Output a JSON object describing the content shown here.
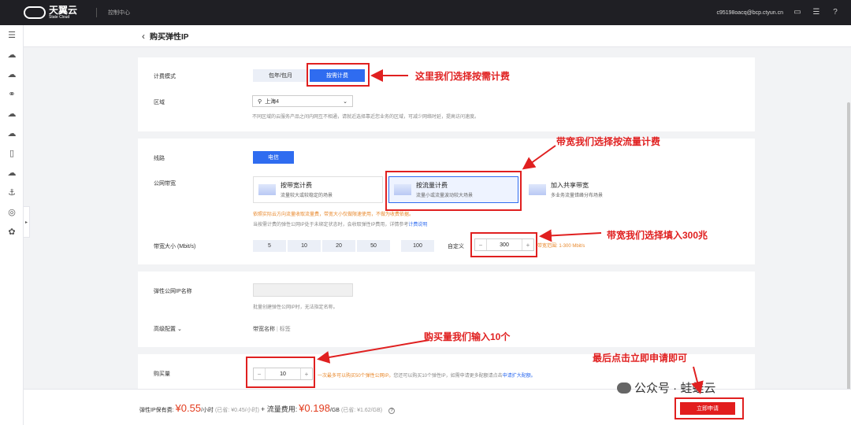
{
  "topbar": {
    "logo_cn": "天翼云",
    "logo_en": "State Cloud",
    "console": "控制中心",
    "account": "c95198oacq@bcp.ctyun.cn"
  },
  "page": {
    "back_icon": "chevron-left-icon",
    "title": "购买弹性IP"
  },
  "billing": {
    "label": "计费模式",
    "options": [
      "包年/包月",
      "按需计费"
    ],
    "selected": "按需计费",
    "region_label": "区域",
    "region_value": "上海4",
    "region_hint": "不同区域的云服务产品之间内网互不相通，请就近选择靠近您业务的区域，可减少网络时延，提高访问速度。"
  },
  "network": {
    "line_label": "线路",
    "line_value": "电信",
    "bandwidth_label": "公网带宽",
    "cards": [
      {
        "title": "按带宽计费",
        "desc": "流量较大或较稳定的场景"
      },
      {
        "title": "按流量计费",
        "desc": "流量小或流量波动较大场景"
      },
      {
        "title": "加入共享带宽",
        "desc": "多业务流量错峰分布场景"
      }
    ],
    "warn": "依照实际云方向流量收取流量费，带宽大小仅做限速使用，不做为收费依据。",
    "hint2": "当按需计费的弹性公网IP处于未绑定状态时，会收取弹性IP费用，详情参考",
    "hint2_link": "计费说明",
    "size_label": "带宽大小 (Mbit/s)",
    "presets": [
      "5",
      "10",
      "20",
      "50",
      "100"
    ],
    "custom_label": "自定义",
    "value": "300",
    "range_label": "带宽范围: 1-300 Mbit/s"
  },
  "naming": {
    "name_label": "弹性公网IP名称",
    "name_placeholder": "",
    "name_hint": "批量创建弹性公网IP时，无法指定名称。",
    "advanced_label": "高级配置",
    "advanced_items": [
      "带宽名称",
      "标签"
    ]
  },
  "quantity": {
    "label": "购买量",
    "value": "10",
    "hint_pre": "一次最多可以购买50个弹性公网IP。",
    "hint_mid": "您还可以购买10个弹性IP，如需申请更多配额请点击",
    "hint_link": "申请扩大配额。"
  },
  "footer": {
    "eip_label": "弹性IP保有费:",
    "eip_price": "¥0.55",
    "eip_unit": "/小时",
    "eip_saved": "(已省: ¥0.45/小时)",
    "plus": "+ 流量费用:",
    "traffic_price": "¥0.198",
    "traffic_unit": "/GB",
    "traffic_saved": "(已省: ¥1.62/GB)",
    "apply": "立即申请"
  },
  "annotations": {
    "a1": "这里我们选择按需计费",
    "a2": "带宽我们选择按流量计费",
    "a3": "带宽我们选择填入300兆",
    "a4": "购买量我们输入10个",
    "a5": "最后点击立即申请即可"
  },
  "watermark": "公众号 · 蛙蛙云",
  "colors": {
    "primary": "#2f6cf0",
    "annotation": "#e02020",
    "price": "#e23c1e",
    "topbar": "#1f1f24"
  }
}
